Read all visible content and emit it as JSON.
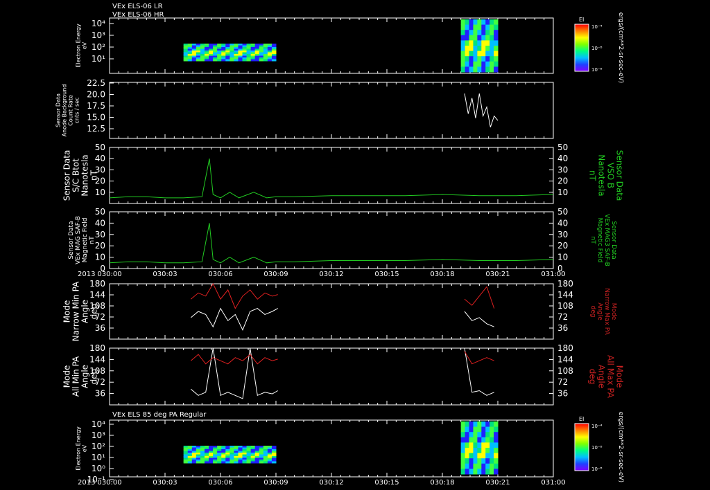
{
  "header": {
    "line1": "VEx ELS-06 LR",
    "line2": "VEx ELS-06 HR",
    "footer_title": "VEx ELS 85 deg PA Regular",
    "year": "2013"
  },
  "colors": {
    "background": "#000000",
    "axis": "#ffffff",
    "white_trace": "#ffffff",
    "green_trace": "#22cc22",
    "red_trace": "#e02020",
    "green_label": "#22cc22",
    "red_label": "#cc2222"
  },
  "x_ticks": [
    "030:00",
    "030:03",
    "030:06",
    "030:09",
    "030:12",
    "030:15",
    "030:18",
    "030:21",
    "031:00"
  ],
  "colorbar": {
    "label": "EI",
    "ticks": [
      "10⁻⁴",
      "10⁻⁸",
      "10⁻⁸"
    ],
    "units": "ergs/(cm**2-sr-sec-eV)"
  },
  "panels": {
    "p1": {
      "label": [
        "Electron Energy",
        "eV"
      ],
      "ticks": [
        "10⁴",
        "10³",
        "10²",
        "10¹"
      ]
    },
    "p2": {
      "label": [
        "Sensor Data",
        "Anode Background",
        "Count Rate",
        "cnts / sec"
      ],
      "ticks": [
        "22.5",
        "20.0",
        "17.5",
        "15.0",
        "12.5"
      ]
    },
    "p3": {
      "label": [
        "Sensor Data",
        "S/C Btot",
        "Nanotesla",
        "nT"
      ],
      "right_label": [
        "Sensor Data",
        "VSO B",
        "Nanotesla",
        "nT"
      ],
      "ticks": [
        "50",
        "40",
        "30",
        "20",
        "10"
      ]
    },
    "p4": {
      "label": [
        "Sensor Data",
        "VEx MAG SAF-B",
        "Magnetic Field",
        "nT"
      ],
      "right_label": [
        "Sensor Data",
        "VEx MAG3 SAF-B",
        "Magnetic Field",
        "nT"
      ],
      "ticks": [
        "50",
        "40",
        "30",
        "20",
        "10",
        "0"
      ]
    },
    "p5": {
      "label": [
        "Mode",
        "Narrow Min PA",
        "Angle",
        "deg"
      ],
      "right_label": [
        "Mode",
        "Narrow Max PA",
        "Angle",
        "deg"
      ],
      "ticks": [
        "180",
        "144",
        "108",
        "72",
        "36"
      ]
    },
    "p6": {
      "label": [
        "Mode",
        "All Min PA",
        "Angle",
        "deg"
      ],
      "right_label": [
        "Mode",
        "All Max PA",
        "Angle",
        "deg"
      ],
      "ticks": [
        "180",
        "144",
        "108",
        "72",
        "36"
      ]
    },
    "p7": {
      "label": [
        "Electron Energy",
        "eV"
      ],
      "ticks": [
        "10⁴",
        "10³",
        "10²",
        "10¹",
        "10⁰",
        "10⁻¹"
      ]
    }
  },
  "chart_data": [
    {
      "type": "heatmap",
      "panel": "p1",
      "title": "VEx ELS-06 LR / VEx ELS-06 HR",
      "ylabel": "Electron Energy eV",
      "yscale": "log",
      "x_range": [
        "030:00",
        "031:00"
      ],
      "data_intervals": [
        [
          "030:04",
          "030:09"
        ],
        [
          "030:19",
          "030:21"
        ]
      ]
    },
    {
      "type": "line",
      "panel": "p2",
      "ylabel": "Sensor Data Anode Background Count Rate cnts / sec",
      "ylim": [
        10,
        22.5
      ],
      "series": [
        {
          "color": "#ffffff",
          "x": [
            19.2,
            19.4,
            19.6,
            19.8,
            20.0,
            20.2,
            20.4,
            20.6,
            20.8,
            21.0
          ],
          "y": [
            20.0,
            15.5,
            19.0,
            14.5,
            20.0,
            15.0,
            17.0,
            12.5,
            15.0,
            14.0
          ]
        }
      ]
    },
    {
      "type": "line",
      "panel": "p3",
      "ylabel": "Sensor Data S/C Btot Nanotesla nT",
      "ylim": [
        0,
        50
      ],
      "series": [
        {
          "color": "#22cc22",
          "x": [
            0,
            1,
            2,
            3,
            4,
            5.0,
            5.4,
            5.6,
            6,
            6.5,
            7,
            7.8,
            8.5,
            9,
            10,
            12,
            14,
            16,
            18,
            20,
            22,
            24
          ],
          "y": [
            5,
            6,
            6,
            5,
            5,
            6,
            40,
            8,
            5,
            10,
            5,
            10,
            5,
            6,
            6,
            7,
            7,
            7,
            8,
            7,
            7,
            8
          ]
        }
      ]
    },
    {
      "type": "line",
      "panel": "p4",
      "ylabel": "Sensor Data VEx MAG SAF-B Magnetic Field nT",
      "ylim": [
        0,
        50
      ],
      "series": [
        {
          "color": "#22cc22",
          "x": [
            0,
            1,
            2,
            3,
            4,
            5.0,
            5.4,
            5.6,
            6,
            6.5,
            7,
            7.8,
            8.5,
            9,
            10,
            12,
            14,
            16,
            18,
            20,
            22,
            24
          ],
          "y": [
            5,
            6,
            6,
            5,
            5,
            6,
            40,
            8,
            5,
            10,
            5,
            10,
            5,
            6,
            6,
            7,
            7,
            7,
            8,
            7,
            7,
            8
          ]
        }
      ]
    },
    {
      "type": "line",
      "panel": "p5",
      "ylabel": "Mode Narrow Min PA Angle deg",
      "ylim": [
        0,
        180
      ],
      "series": [
        {
          "color": "#ffffff",
          "x": [
            4.4,
            4.8,
            5.2,
            5.6,
            6.0,
            6.4,
            6.8,
            7.2,
            7.6,
            8.0,
            8.4,
            8.8,
            9.1,
            19.2,
            19.6,
            20.0,
            20.4,
            20.8
          ],
          "y": [
            70,
            90,
            80,
            40,
            100,
            60,
            80,
            30,
            90,
            100,
            80,
            90,
            100,
            90,
            60,
            70,
            50,
            40
          ]
        },
        {
          "color": "#e02020",
          "x": [
            4.4,
            4.8,
            5.2,
            5.6,
            6.0,
            6.4,
            6.8,
            7.2,
            7.6,
            8.0,
            8.4,
            8.8,
            9.1,
            19.2,
            19.6,
            20.0,
            20.4,
            20.8
          ],
          "y": [
            130,
            150,
            140,
            180,
            130,
            160,
            100,
            140,
            160,
            130,
            150,
            140,
            145,
            130,
            110,
            140,
            170,
            100
          ]
        }
      ]
    },
    {
      "type": "line",
      "panel": "p6",
      "ylabel": "Mode All Min PA Angle deg",
      "ylim": [
        0,
        180
      ],
      "series": [
        {
          "color": "#ffffff",
          "x": [
            4.4,
            4.8,
            5.2,
            5.6,
            6.0,
            6.4,
            6.8,
            7.2,
            7.6,
            8.0,
            8.4,
            8.8,
            9.1,
            19.2,
            19.6,
            20.0,
            20.4,
            20.8
          ],
          "y": [
            50,
            30,
            40,
            180,
            30,
            40,
            30,
            20,
            180,
            30,
            40,
            35,
            45,
            180,
            40,
            45,
            30,
            40
          ]
        },
        {
          "color": "#e02020",
          "x": [
            4.4,
            4.8,
            5.2,
            5.6,
            6.0,
            6.4,
            6.8,
            7.2,
            7.6,
            8.0,
            8.4,
            8.8,
            9.1,
            19.2,
            19.6,
            20.0,
            20.4,
            20.8
          ],
          "y": [
            140,
            160,
            130,
            150,
            140,
            130,
            150,
            140,
            160,
            130,
            150,
            140,
            145,
            170,
            130,
            140,
            150,
            140
          ]
        }
      ]
    },
    {
      "type": "heatmap",
      "panel": "p7",
      "title": "VEx ELS 85 deg PA Regular",
      "ylabel": "Electron Energy eV",
      "yscale": "log",
      "x_range": [
        "030:00",
        "031:00"
      ],
      "data_intervals": [
        [
          "030:04",
          "030:09"
        ],
        [
          "030:19",
          "030:21"
        ]
      ]
    }
  ]
}
